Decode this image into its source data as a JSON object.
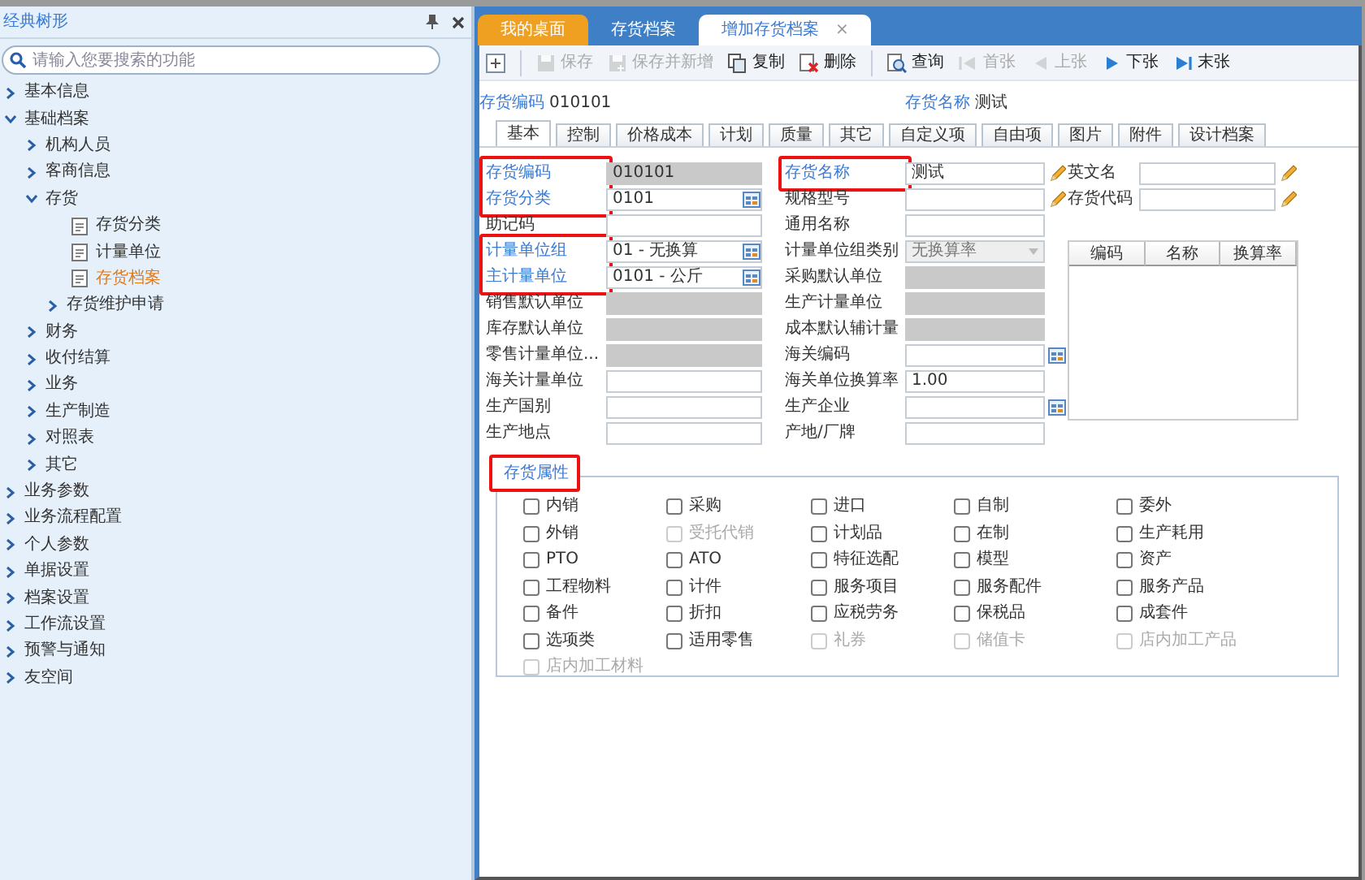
{
  "sidebar": {
    "title": "经典树形",
    "search": {
      "placeholder": "请输入您要搜索的功能"
    },
    "tree": [
      {
        "label": "基本信息",
        "kind": "group",
        "expanded": false,
        "selected": false
      },
      {
        "label": "基础档案",
        "kind": "group",
        "expanded": true,
        "selected": false,
        "children": [
          {
            "label": "机构人员",
            "kind": "group",
            "expanded": false,
            "selected": false
          },
          {
            "label": "客商信息",
            "kind": "group",
            "expanded": false,
            "selected": false
          },
          {
            "label": "存货",
            "kind": "group",
            "expanded": true,
            "selected": false,
            "children": [
              {
                "label": "存货分类",
                "kind": "page",
                "selected": false
              },
              {
                "label": "计量单位",
                "kind": "page",
                "selected": false
              },
              {
                "label": "存货档案",
                "kind": "page",
                "selected": true
              },
              {
                "label": "存货维护申请",
                "kind": "group",
                "expanded": false,
                "selected": false
              }
            ]
          },
          {
            "label": "财务",
            "kind": "group",
            "expanded": false,
            "selected": false
          },
          {
            "label": "收付结算",
            "kind": "group",
            "expanded": false,
            "selected": false
          },
          {
            "label": "业务",
            "kind": "group",
            "expanded": false,
            "selected": false
          },
          {
            "label": "生产制造",
            "kind": "group",
            "expanded": false,
            "selected": false
          },
          {
            "label": "对照表",
            "kind": "group",
            "expanded": false,
            "selected": false
          },
          {
            "label": "其它",
            "kind": "group",
            "expanded": false,
            "selected": false
          }
        ]
      },
      {
        "label": "业务参数",
        "kind": "group",
        "expanded": false,
        "selected": false
      },
      {
        "label": "业务流程配置",
        "kind": "group",
        "expanded": false,
        "selected": false
      },
      {
        "label": "个人参数",
        "kind": "group",
        "expanded": false,
        "selected": false
      },
      {
        "label": "单据设置",
        "kind": "group",
        "expanded": false,
        "selected": false
      },
      {
        "label": "档案设置",
        "kind": "group",
        "expanded": false,
        "selected": false
      },
      {
        "label": "工作流设置",
        "kind": "group",
        "expanded": false,
        "selected": false
      },
      {
        "label": "预警与通知",
        "kind": "group",
        "expanded": false,
        "selected": false
      },
      {
        "label": "友空间",
        "kind": "group",
        "expanded": false,
        "selected": false
      }
    ]
  },
  "doc_tabs": [
    {
      "label": "我的桌面",
      "kind": "home",
      "selected": false
    },
    {
      "label": "存货档案",
      "kind": "page",
      "selected": false
    },
    {
      "label": "增加存货档案",
      "kind": "page",
      "selected": true,
      "close": "×"
    }
  ],
  "toolbar": [
    {
      "disabled": false
    },
    {
      "label": "保存",
      "disabled": true
    },
    {
      "label": "保存并新增",
      "disabled": true
    },
    {
      "label": "复制",
      "disabled": false
    },
    {
      "label": "删除",
      "disabled": false
    },
    {
      "label": "查询",
      "disabled": false
    },
    {
      "label": "首张",
      "disabled": true
    },
    {
      "label": "上张",
      "disabled": true
    },
    {
      "label": "下张",
      "disabled": false
    },
    {
      "label": "末张",
      "disabled": false
    }
  ],
  "header": [
    {
      "label": "存货编码",
      "value": "010101"
    },
    {
      "label": "存货名称",
      "value": "测试"
    }
  ],
  "form_tabs": [
    {
      "label": "基本",
      "selected": true
    },
    {
      "label": "控制",
      "selected": false
    },
    {
      "label": "价格成本",
      "selected": false
    },
    {
      "label": "计划",
      "selected": false
    },
    {
      "label": "质量",
      "selected": false
    },
    {
      "label": "其它",
      "selected": false
    },
    {
      "label": "自定义项",
      "selected": false
    },
    {
      "label": "自由项",
      "selected": false
    },
    {
      "label": "图片",
      "selected": false
    },
    {
      "label": "附件",
      "selected": false
    },
    {
      "label": "设计档案",
      "selected": false
    }
  ],
  "left_fields": [
    {
      "label": "存货编码",
      "required": true,
      "marked": true,
      "kind": "readonly",
      "value": "010101"
    },
    {
      "label": "存货分类",
      "required": true,
      "marked": true,
      "kind": "ref",
      "value": "0101"
    },
    {
      "label": "助记码",
      "required": false,
      "marked": false,
      "kind": "input"
    },
    {
      "label": "计量单位组",
      "required": true,
      "marked": true,
      "kind": "ref",
      "value": "01 - 无换算"
    },
    {
      "label": "主计量单位",
      "required": true,
      "marked": true,
      "kind": "ref",
      "value": "0101 - 公斤"
    },
    {
      "label": "销售默认单位",
      "required": false,
      "marked": false,
      "kind": "readonly"
    },
    {
      "label": "库存默认单位",
      "required": false,
      "marked": false,
      "kind": "readonly"
    },
    {
      "label": "零售计量单位...",
      "required": false,
      "marked": false,
      "kind": "readonly"
    },
    {
      "label": "海关计量单位",
      "required": false,
      "marked": false,
      "kind": "input"
    },
    {
      "label": "生产国别",
      "required": false,
      "marked": false,
      "kind": "input"
    },
    {
      "label": "生产地点",
      "required": false,
      "marked": false,
      "kind": "input"
    }
  ],
  "middle_fields": [
    {
      "label": "存货名称",
      "required": true,
      "marked": true,
      "kind": "edit",
      "value": "测试"
    },
    {
      "label": "规格型号",
      "required": false,
      "marked": false,
      "kind": "edit"
    },
    {
      "label": "通用名称",
      "required": false,
      "marked": false,
      "kind": "input"
    },
    {
      "label": "计量单位组类别",
      "required": false,
      "marked": false,
      "kind": "select",
      "value": "无换算率"
    },
    {
      "label": "采购默认单位",
      "required": false,
      "marked": false,
      "kind": "readonly"
    },
    {
      "label": "生产计量单位",
      "required": false,
      "marked": false,
      "kind": "readonly"
    },
    {
      "label": "成本默认辅计量",
      "required": false,
      "marked": false,
      "kind": "readonly"
    },
    {
      "label": "海关编码",
      "required": false,
      "marked": false,
      "kind": "ref"
    },
    {
      "label": "海关单位换算率",
      "required": false,
      "marked": false,
      "kind": "input",
      "value": "1.00"
    },
    {
      "label": "生产企业",
      "required": false,
      "marked": false,
      "kind": "ref"
    },
    {
      "label": "产地/厂牌",
      "required": false,
      "marked": false,
      "kind": "input"
    }
  ],
  "right_fields": [
    {
      "label": "英文名",
      "required": false,
      "marked": false,
      "kind": "edit"
    },
    {
      "label": "存货代码",
      "required": false,
      "marked": false,
      "kind": "edit"
    }
  ],
  "unit_table": {
    "columns": [
      "编码",
      "名称",
      "换算率"
    ]
  },
  "attributes": {
    "title": "存货属性",
    "marked": true,
    "items": [
      {
        "label": "内销",
        "checked": false,
        "disabled": false
      },
      {
        "label": "采购",
        "checked": false,
        "disabled": false
      },
      {
        "label": "进口",
        "checked": false,
        "disabled": false
      },
      {
        "label": "自制",
        "checked": false,
        "disabled": false
      },
      {
        "label": "委外",
        "checked": false,
        "disabled": false
      },
      {
        "label": "外销",
        "checked": false,
        "disabled": false
      },
      {
        "label": "受托代销",
        "checked": false,
        "disabled": true
      },
      {
        "label": "计划品",
        "checked": false,
        "disabled": false
      },
      {
        "label": "在制",
        "checked": false,
        "disabled": false
      },
      {
        "label": "生产耗用",
        "checked": false,
        "disabled": false
      },
      {
        "label": "PTO",
        "checked": false,
        "disabled": false
      },
      {
        "label": "ATO",
        "checked": false,
        "disabled": false
      },
      {
        "label": "特征选配",
        "checked": false,
        "disabled": false
      },
      {
        "label": "模型",
        "checked": false,
        "disabled": false
      },
      {
        "label": "资产",
        "checked": false,
        "disabled": false
      },
      {
        "label": "工程物料",
        "checked": false,
        "disabled": false
      },
      {
        "label": "计件",
        "checked": false,
        "disabled": false
      },
      {
        "label": "服务项目",
        "checked": false,
        "disabled": false
      },
      {
        "label": "服务配件",
        "checked": false,
        "disabled": false
      },
      {
        "label": "服务产品",
        "checked": false,
        "disabled": false
      },
      {
        "label": "备件",
        "checked": false,
        "disabled": false
      },
      {
        "label": "折扣",
        "checked": false,
        "disabled": false
      },
      {
        "label": "应税劳务",
        "checked": false,
        "disabled": false
      },
      {
        "label": "保税品",
        "checked": false,
        "disabled": false
      },
      {
        "label": "成套件",
        "checked": false,
        "disabled": false
      },
      {
        "label": "选项类",
        "checked": false,
        "disabled": false
      },
      {
        "label": "适用零售",
        "checked": false,
        "disabled": false
      },
      {
        "label": "礼券",
        "checked": false,
        "disabled": true
      },
      {
        "label": "储值卡",
        "checked": false,
        "disabled": true
      },
      {
        "label": "店内加工产品",
        "checked": false,
        "disabled": true
      },
      {
        "label": "店内加工材料",
        "checked": false,
        "disabled": true
      }
    ]
  }
}
